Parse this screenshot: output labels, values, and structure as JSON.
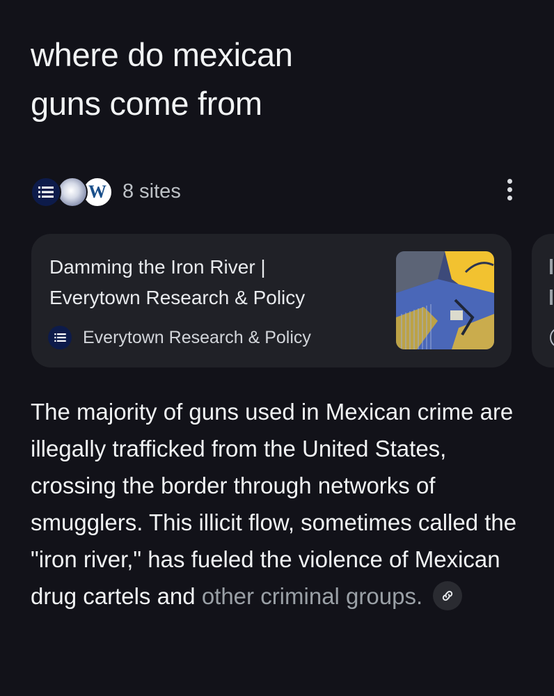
{
  "query": {
    "line1": "where do mexican",
    "line2": "guns come from"
  },
  "sources": {
    "count_label": "8 sites",
    "favicons": [
      "list-icon",
      "globe-icon",
      "wikipedia-w-icon"
    ],
    "wiki_letter": "W"
  },
  "card": {
    "title_line1": "Damming the Iron River |",
    "title_line2": "Everytown Research & Policy",
    "source_name": "Everytown Research & Policy"
  },
  "answer": {
    "main": "The majority of guns used in Mexican crime are illegally trafficked from the United States, crossing the border through networks of smugglers. This illicit flow, sometimes called the \"iron river,\" has fueled the violence of Mexican drug cartels and ",
    "faded": "other criminal groups."
  },
  "colors": {
    "background": "#121219",
    "card": "#202127",
    "brand_navy": "#0d1b4a",
    "thumb_yellow": "#f2c230",
    "thumb_blue": "#4a67b8"
  }
}
